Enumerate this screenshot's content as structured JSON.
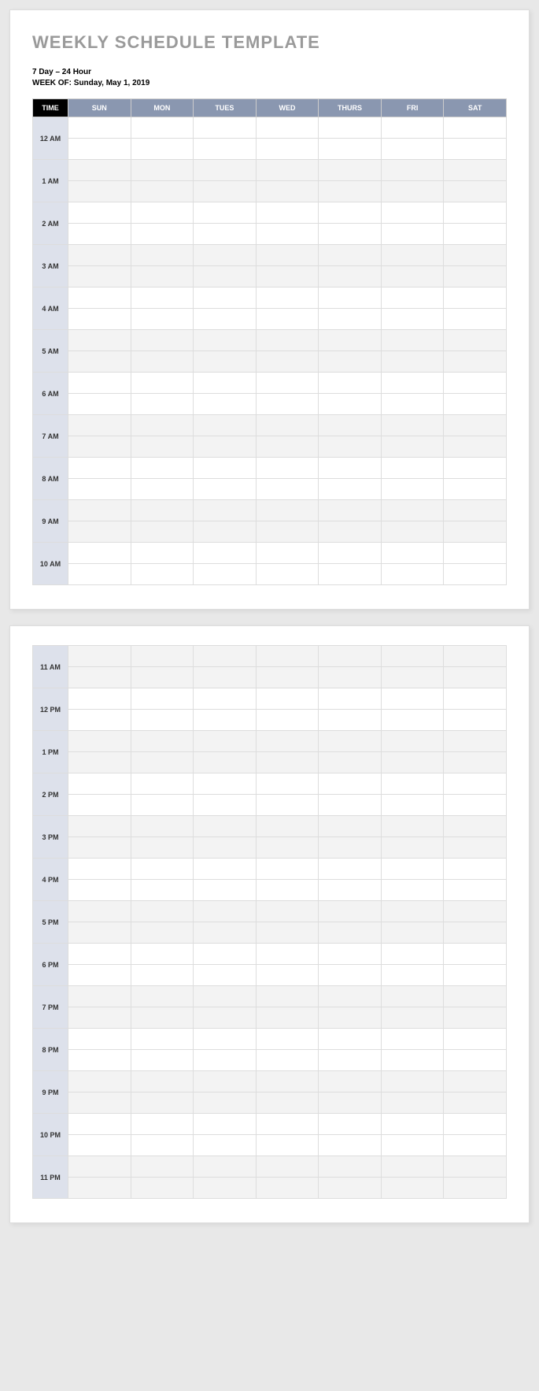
{
  "title": "WEEKLY SCHEDULE TEMPLATE",
  "subtitle_line1": "7 Day – 24 Hour",
  "subtitle_line2_label": "WEEK OF:",
  "subtitle_line2_value": "Sunday, May 1, 2019",
  "header": {
    "time": "TIME",
    "days": [
      "SUN",
      "MON",
      "TUES",
      "WED",
      "THURS",
      "FRI",
      "SAT"
    ]
  },
  "hours_page1": [
    "12 AM",
    "1 AM",
    "2 AM",
    "3 AM",
    "4 AM",
    "5 AM",
    "6 AM",
    "7 AM",
    "8 AM",
    "9 AM",
    "10 AM"
  ],
  "hours_page2": [
    "11 AM",
    "12 PM",
    "1 PM",
    "2 PM",
    "3 PM",
    "4 PM",
    "5 PM",
    "6 PM",
    "7 PM",
    "8 PM",
    "9 PM",
    "10 PM",
    "11 PM"
  ]
}
